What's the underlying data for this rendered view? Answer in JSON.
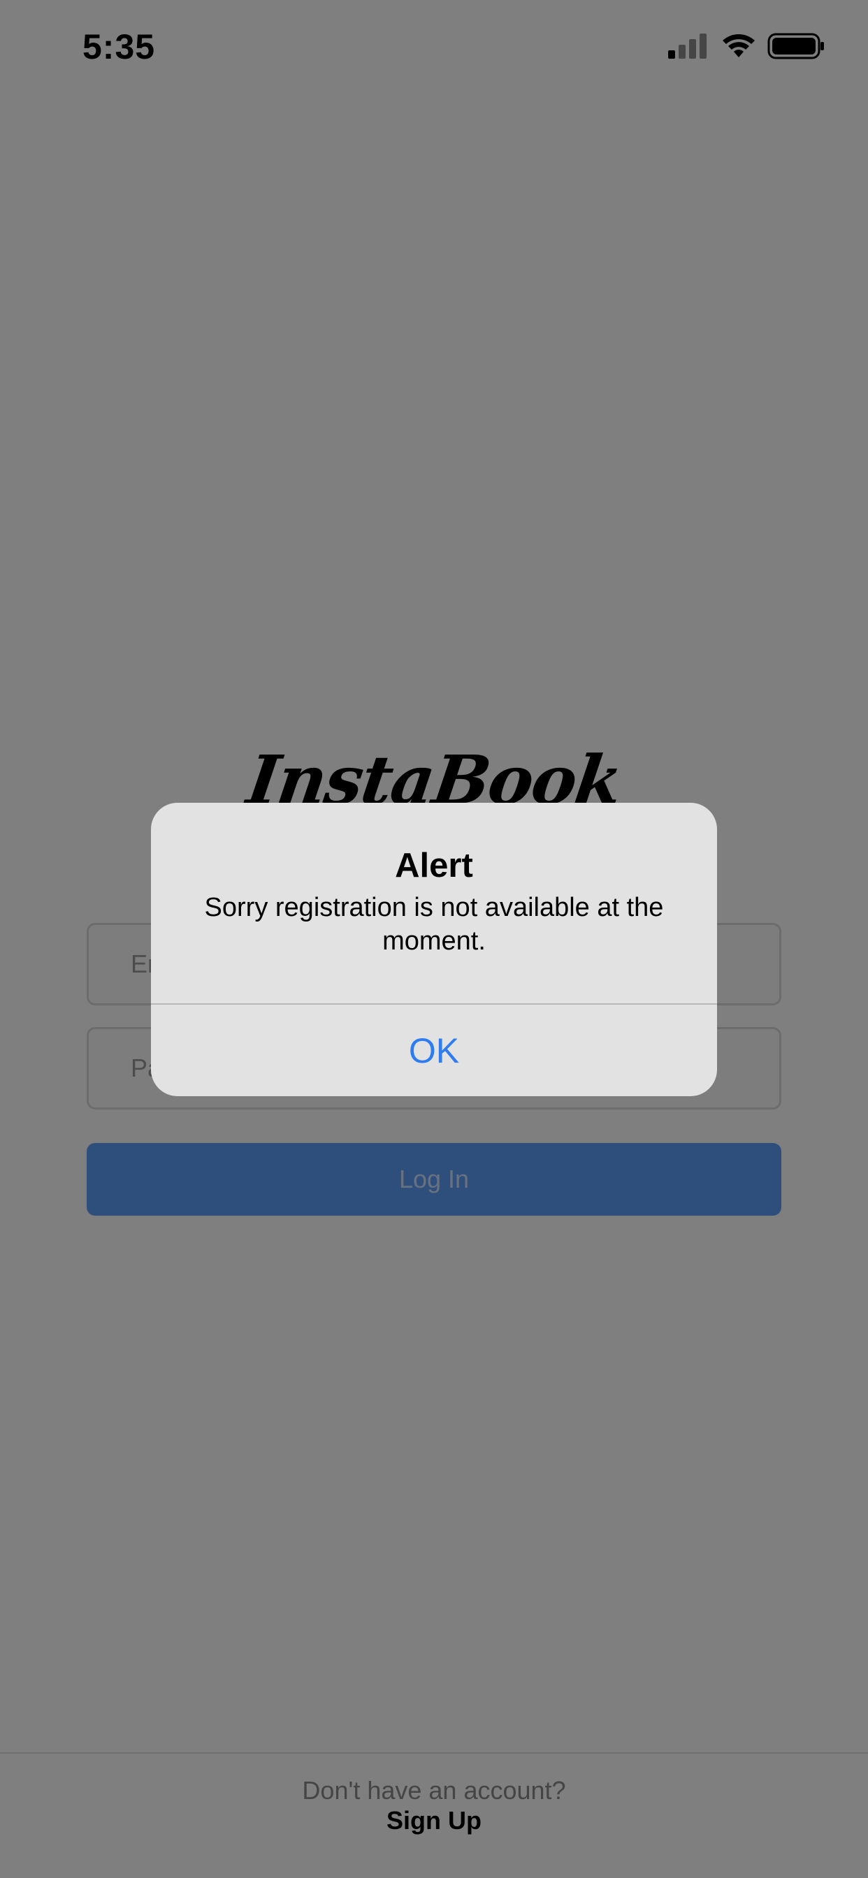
{
  "status_bar": {
    "time": "5:35",
    "icons": [
      "signal-icon",
      "wifi-icon",
      "battery-icon"
    ]
  },
  "login": {
    "logo_text": "InstaBook",
    "email_placeholder": "Email",
    "password_placeholder": "Password",
    "login_label": "Log In"
  },
  "footer": {
    "prompt": "Don't have an account?",
    "signup_label": "Sign Up"
  },
  "alert": {
    "title": "Alert",
    "message": "Sorry registration is not available at the moment.",
    "ok_label": "OK"
  },
  "colors": {
    "accent": "#2f7bf0",
    "login_button": "#5d9ff8",
    "overlay": "rgba(0,0,0,0.5)"
  }
}
